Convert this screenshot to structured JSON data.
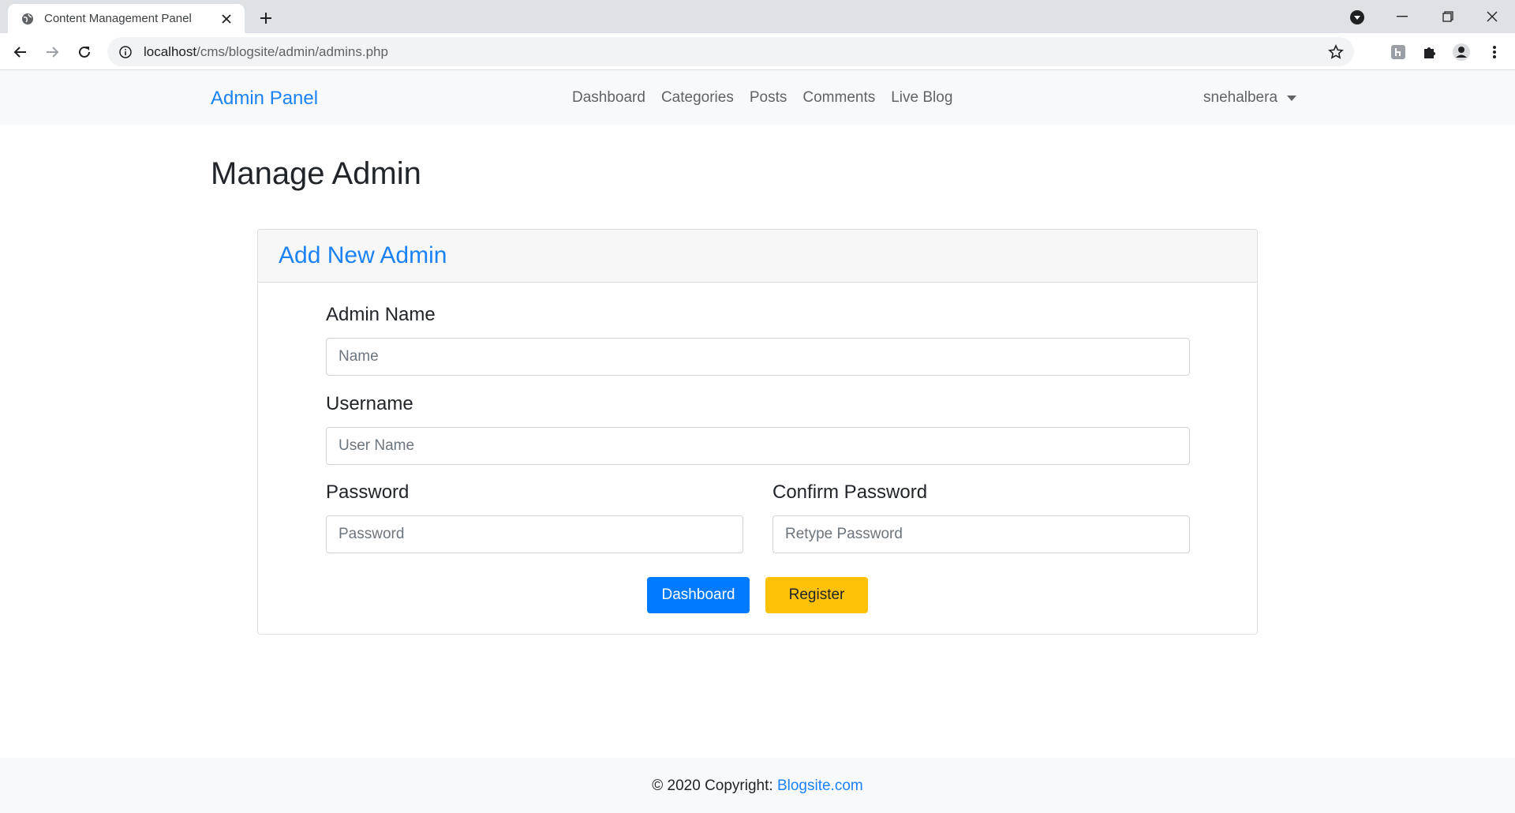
{
  "browser": {
    "tab_title": "Content Management Panel",
    "url_host": "localhost",
    "url_path": "/cms/blogsite/admin/admins.php"
  },
  "navbar": {
    "brand": "Admin Panel",
    "links": [
      "Dashboard",
      "Categories",
      "Posts",
      "Comments",
      "Live Blog"
    ],
    "user": "snehalbera"
  },
  "page": {
    "title": "Manage Admin"
  },
  "form": {
    "header": "Add New Admin",
    "admin_name_label": "Admin Name",
    "admin_name_placeholder": "Name",
    "username_label": "Username",
    "username_placeholder": "User Name",
    "password_label": "Password",
    "password_placeholder": "Password",
    "confirm_label": "Confirm Password",
    "confirm_placeholder": "Retype Password",
    "dashboard_button": "Dashboard",
    "register_button": "Register"
  },
  "footer": {
    "text": "© 2020 Copyright: ",
    "link": "Blogsite.com"
  },
  "colors": {
    "primary": "#007bff",
    "warning": "#ffc107",
    "link": "#1a82f5"
  }
}
